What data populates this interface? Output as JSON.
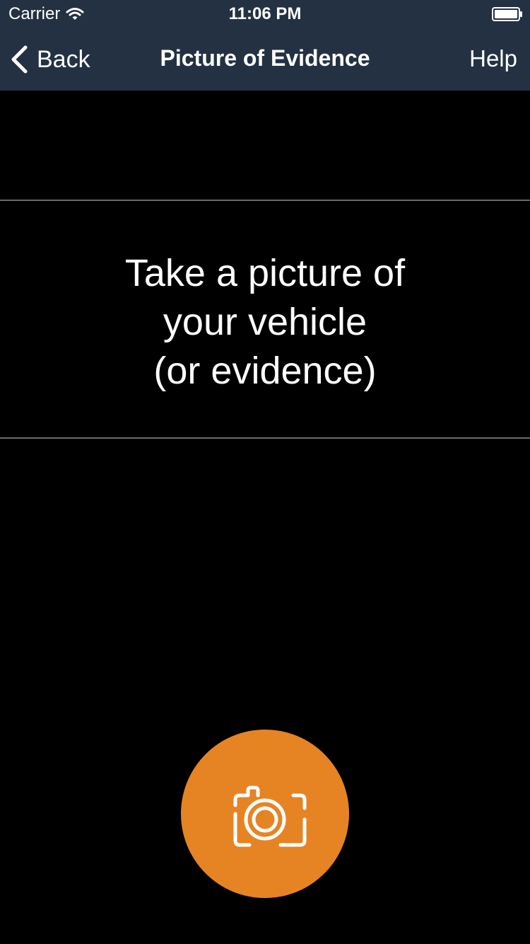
{
  "status_bar": {
    "carrier": "Carrier",
    "time": "11:06 PM",
    "icons": [
      "wifi-icon",
      "battery-icon"
    ]
  },
  "nav_bar": {
    "back_label": "Back",
    "title": "Picture of Evidence",
    "help_label": "Help",
    "background_color": "#243142"
  },
  "instruction": {
    "line1": "Take a picture of",
    "line2": "your vehicle",
    "line3": "(or evidence)"
  },
  "camera_button": {
    "icon": "camera-icon",
    "color": "#e68424"
  }
}
